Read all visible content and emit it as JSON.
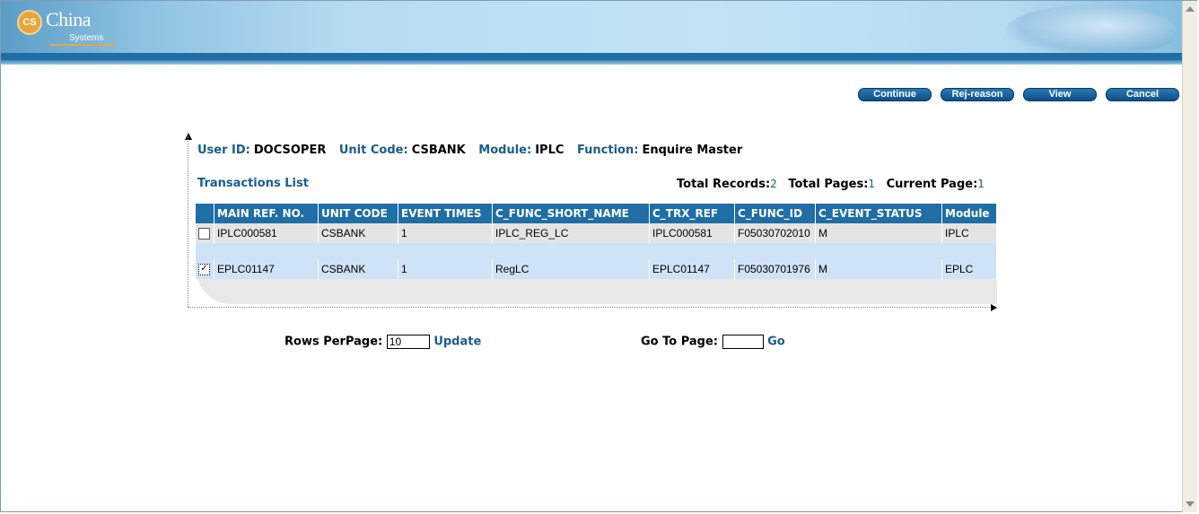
{
  "logo": {
    "badge": "CS",
    "name": "China",
    "sub": "Systems"
  },
  "buttons": {
    "continue": "Continue",
    "rej_reason": "Rej-reason",
    "view": "View",
    "cancel": "Cancel"
  },
  "info": {
    "user_id_label": "User ID:",
    "user_id": "DOCSOPER",
    "unit_code_label": "Unit Code:",
    "unit_code": "CSBANK",
    "module_label": "Module:",
    "module": "IPLC",
    "function_label": "Function:",
    "function": "Enquire Master"
  },
  "list": {
    "title": "Transactions List",
    "total_records_label": "Total Records:",
    "total_records": "2",
    "total_pages_label": "Total Pages:",
    "total_pages": "1",
    "current_page_label": "Current Page:",
    "current_page": "1"
  },
  "table": {
    "columns": [
      "MAIN REF. NO.",
      "UNIT CODE",
      "EVENT TIMES",
      "C_FUNC_SHORT_NAME",
      "C_TRX_REF",
      "C_FUNC_ID",
      "C_EVENT_STATUS",
      "Module"
    ],
    "rows": [
      {
        "checked": false,
        "cells": [
          "IPLC000581",
          "CSBANK",
          "1",
          "IPLC_REG_LC",
          "IPLC000581",
          "F05030702010",
          "M",
          "IPLC"
        ]
      },
      {
        "checked": true,
        "cells": [
          "EPLC01147",
          "CSBANK",
          "1",
          "RegLC",
          "EPLC01147",
          "F05030701976",
          "M",
          "EPLC"
        ]
      }
    ]
  },
  "paging": {
    "rows_per_page_label": "Rows PerPage:",
    "rows_per_page": "10",
    "update": "Update",
    "go_to_page_label": "Go To Page:",
    "go_to_page": "",
    "go": "Go"
  }
}
